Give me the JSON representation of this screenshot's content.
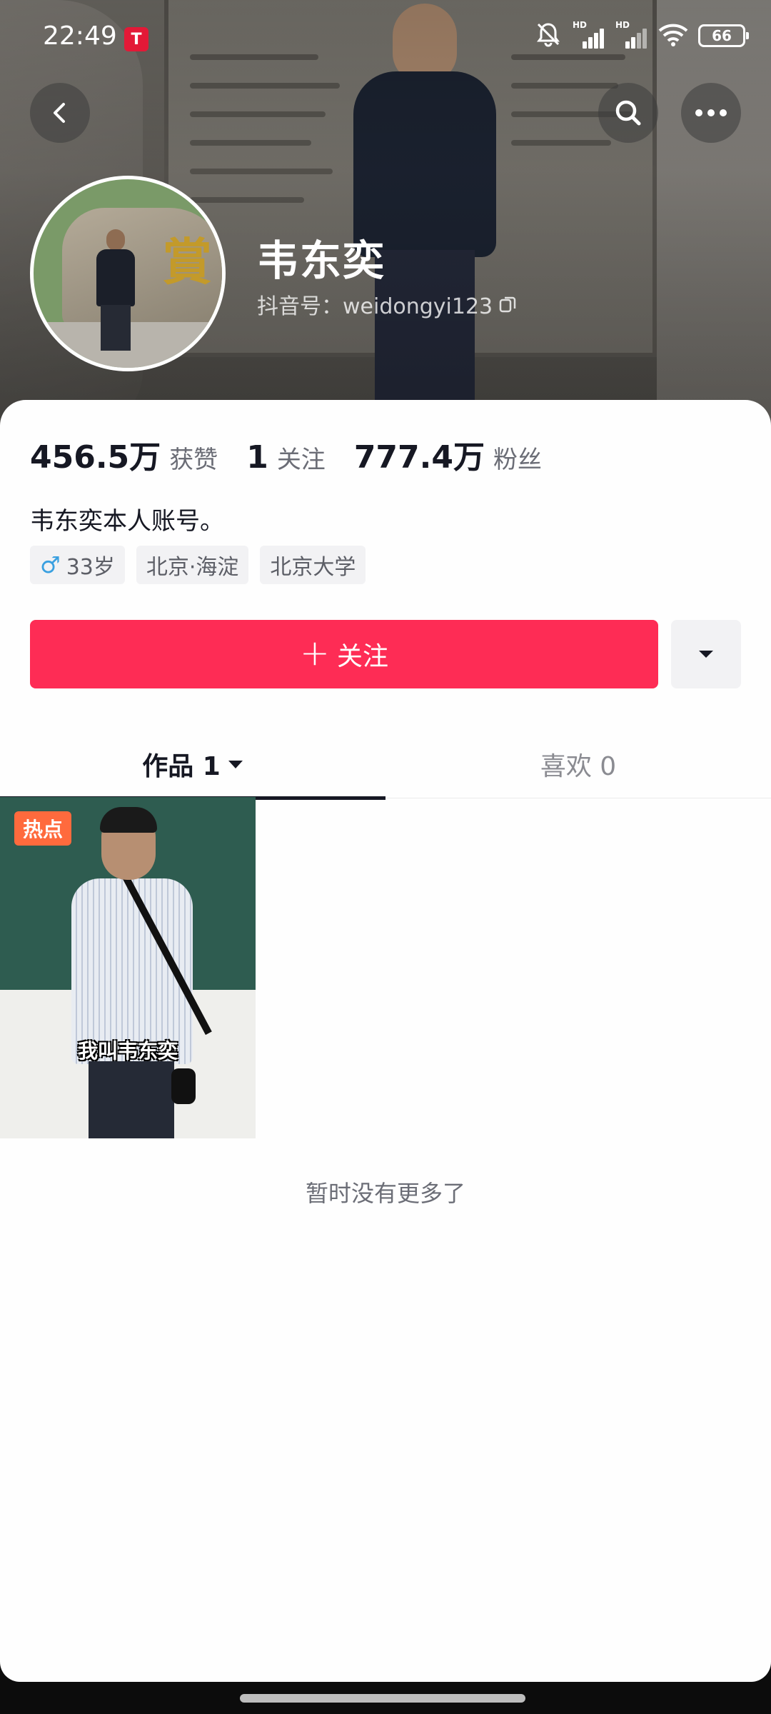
{
  "status_bar": {
    "time": "22:49",
    "app_badge": "T",
    "battery": "66",
    "sim1_hd": "HD",
    "sim2_hd": "HD"
  },
  "header": {
    "icons": {
      "back": "chevron-left-icon",
      "search": "search-icon",
      "more": "more-icon"
    }
  },
  "profile": {
    "name": "韦东奕",
    "douyin_id": "抖音号：weidongyi123"
  },
  "stats": [
    {
      "value": "456.5万",
      "label": "获赞"
    },
    {
      "value": "1",
      "label": "关注"
    },
    {
      "value": "777.4万",
      "label": "粉丝"
    }
  ],
  "bio": "韦东奕本人账号。",
  "tags": {
    "gender_symbol": "♂",
    "age": "33岁",
    "location": "北京·海淀",
    "school": "北京大学"
  },
  "actions": {
    "follow_label": "关注",
    "follow_plus": "+"
  },
  "tabs": {
    "works": "作品 1",
    "likes": "喜欢 0"
  },
  "video": {
    "hot_badge": "热点",
    "caption": "我叫韦东奕"
  },
  "empty_text": "暂时没有更多了",
  "colors": {
    "accent": "#fe2c55",
    "hot": "#ff6a3d",
    "text_primary": "#161823",
    "text_secondary": "#6b6d76"
  }
}
